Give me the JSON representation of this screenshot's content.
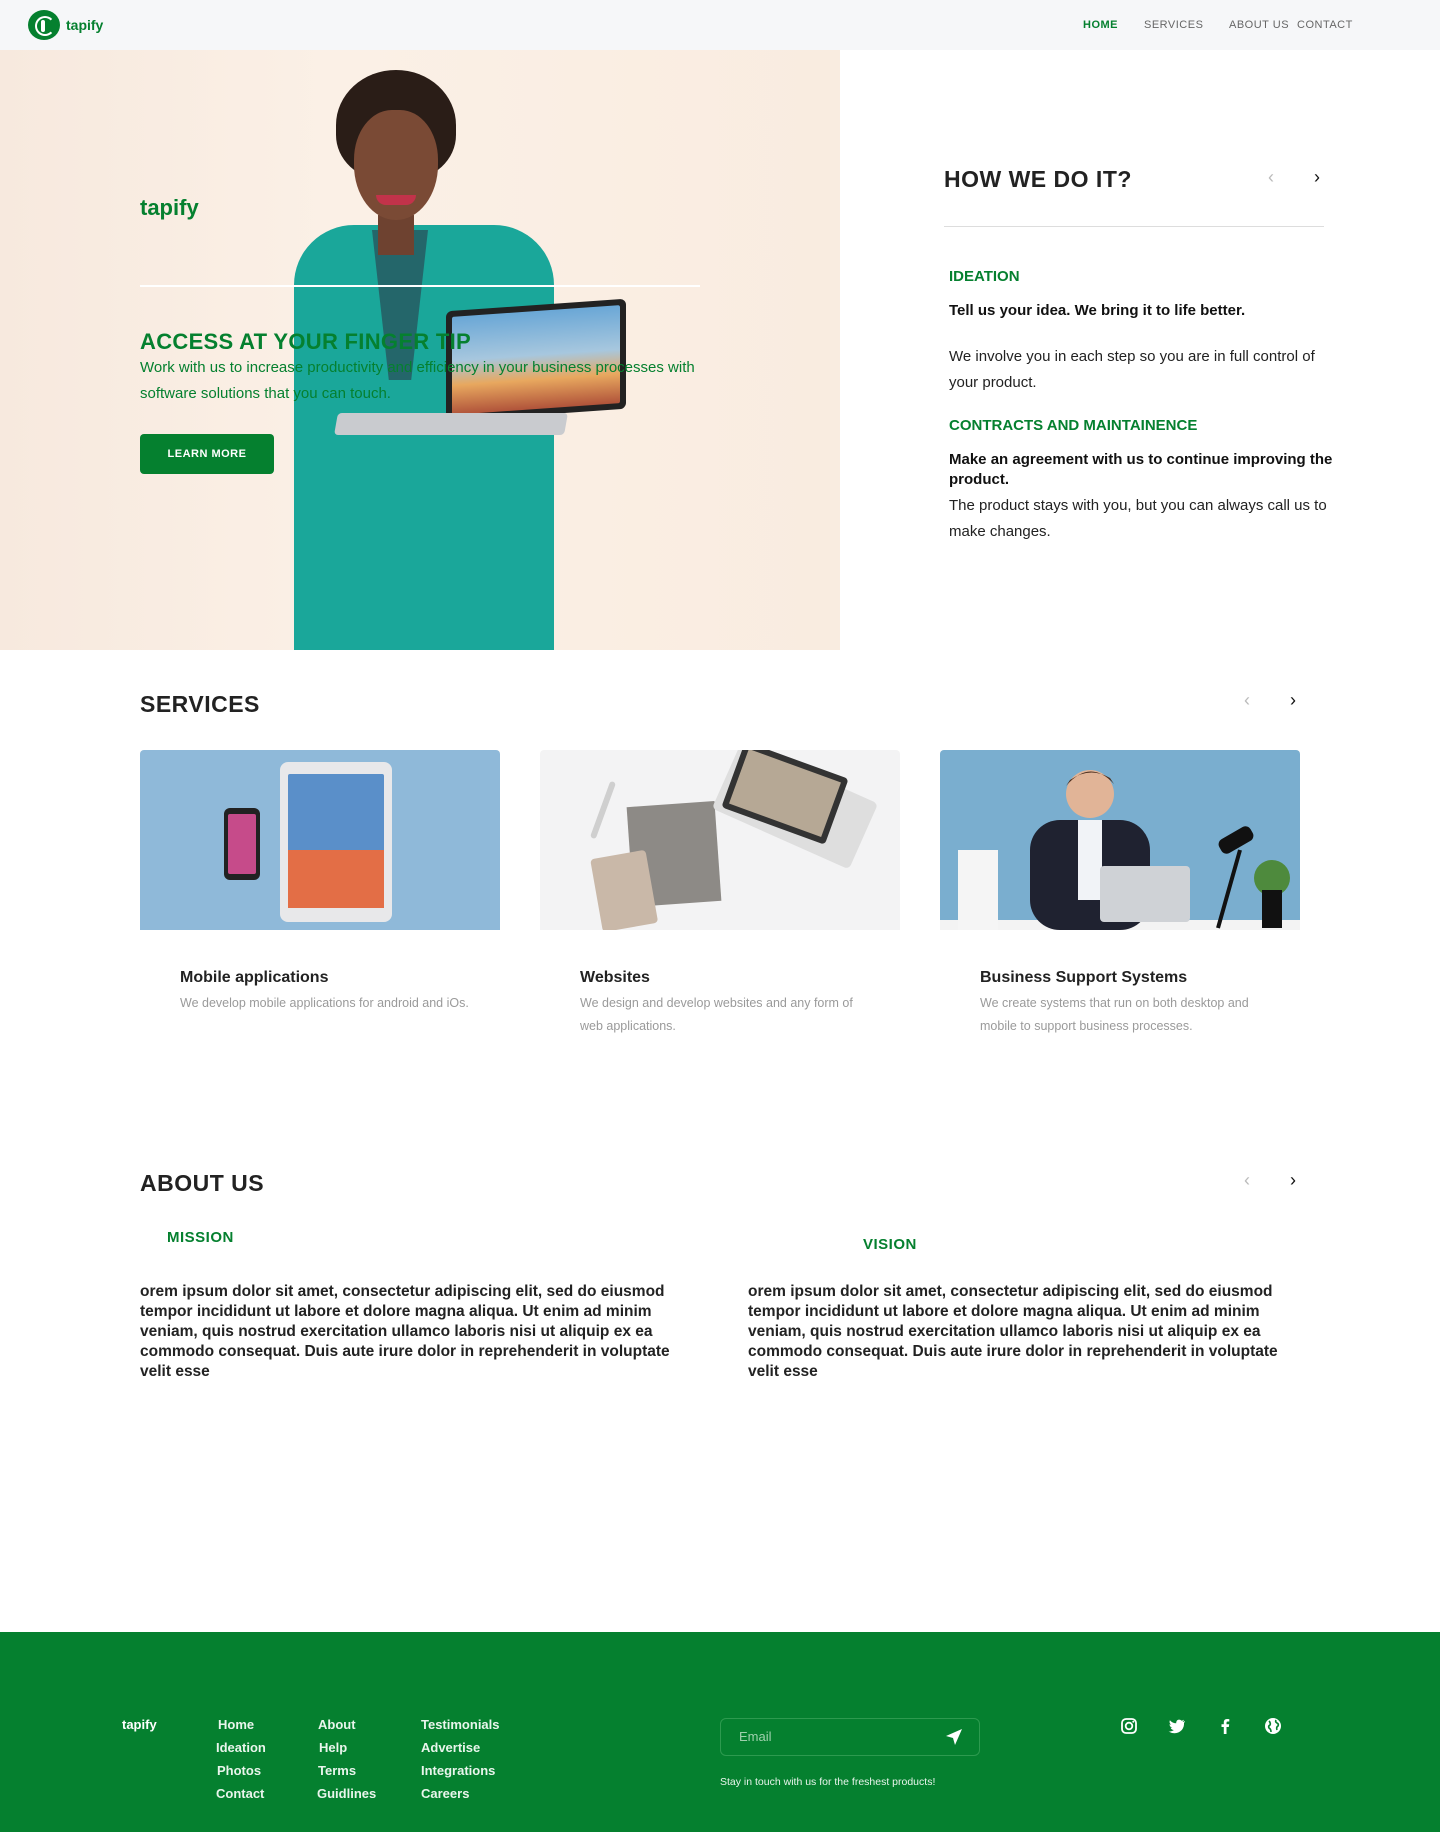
{
  "nav": {
    "brand": "tapify",
    "links": [
      "HOME",
      "SERVICES",
      "ABOUT US",
      "CONTACT"
    ]
  },
  "hero": {
    "brand": "tapify",
    "title": "ACCESS AT YOUR FINGER TIP",
    "description": "Work with us to increase productivity and efficiency in your business processes with software solutions that you can touch.",
    "button": "LEARN MORE"
  },
  "how": {
    "title": "HOW WE DO IT?",
    "steps": [
      {
        "heading": "IDEATION",
        "strong": "Tell us your idea. We bring it to life better.",
        "text": "We involve you in each step so you are in full control of your product."
      },
      {
        "heading": "CONTRACTS AND MAINTAINENCE",
        "strong": "Make an agreement with us to continue improving the product.",
        "text": "The product stays with you, but you can always call us to make changes."
      }
    ]
  },
  "services": {
    "title": "SERVICES",
    "cards": [
      {
        "title": "Mobile applications",
        "desc": "We develop mobile applications for android and iOs."
      },
      {
        "title": "Websites",
        "desc": "We design and develop websites and any form of web applications."
      },
      {
        "title": "Business Support Systems",
        "desc": "We create  systems that run on both desktop and mobile to support business processes."
      }
    ]
  },
  "about": {
    "title": "ABOUT US",
    "mission_heading": "MISSION",
    "vision_heading": "VISION",
    "mission_text": "orem ipsum dolor sit amet, consectetur adipiscing elit, sed do eiusmod tempor incididunt ut labore et dolore magna aliqua. Ut enim ad minim veniam, quis nostrud exercitation ullamco laboris nisi ut aliquip ex ea commodo consequat. Duis aute irure dolor in reprehenderit in voluptate velit esse",
    "vision_text": "orem ipsum dolor sit amet, consectetur adipiscing elit, sed do eiusmod tempor incididunt ut labore et dolore magna aliqua. Ut enim ad minim veniam, quis nostrud exercitation ullamco laboris nisi ut aliquip ex ea commodo consequat. Duis aute irure dolor in reprehenderit in voluptate velit esse"
  },
  "footer": {
    "brand": "tapify",
    "col1": [
      "Home",
      "Ideation",
      "Photos",
      "Contact"
    ],
    "col2": [
      "About",
      "Help",
      "Terms",
      "Guidlines"
    ],
    "col3": [
      "Testimonials",
      "Advertise",
      "Integrations",
      "Careers"
    ],
    "email_placeholder": "Email",
    "note": "Stay in touch with us for the freshest products!",
    "social_icons": [
      "instagram-icon",
      "twitter-icon",
      "facebook-icon",
      "globe-icon"
    ]
  },
  "colors": {
    "brand_green": "#05802f",
    "nav_bg": "#f6f7f9",
    "hero_bg": "#f9ece0"
  }
}
